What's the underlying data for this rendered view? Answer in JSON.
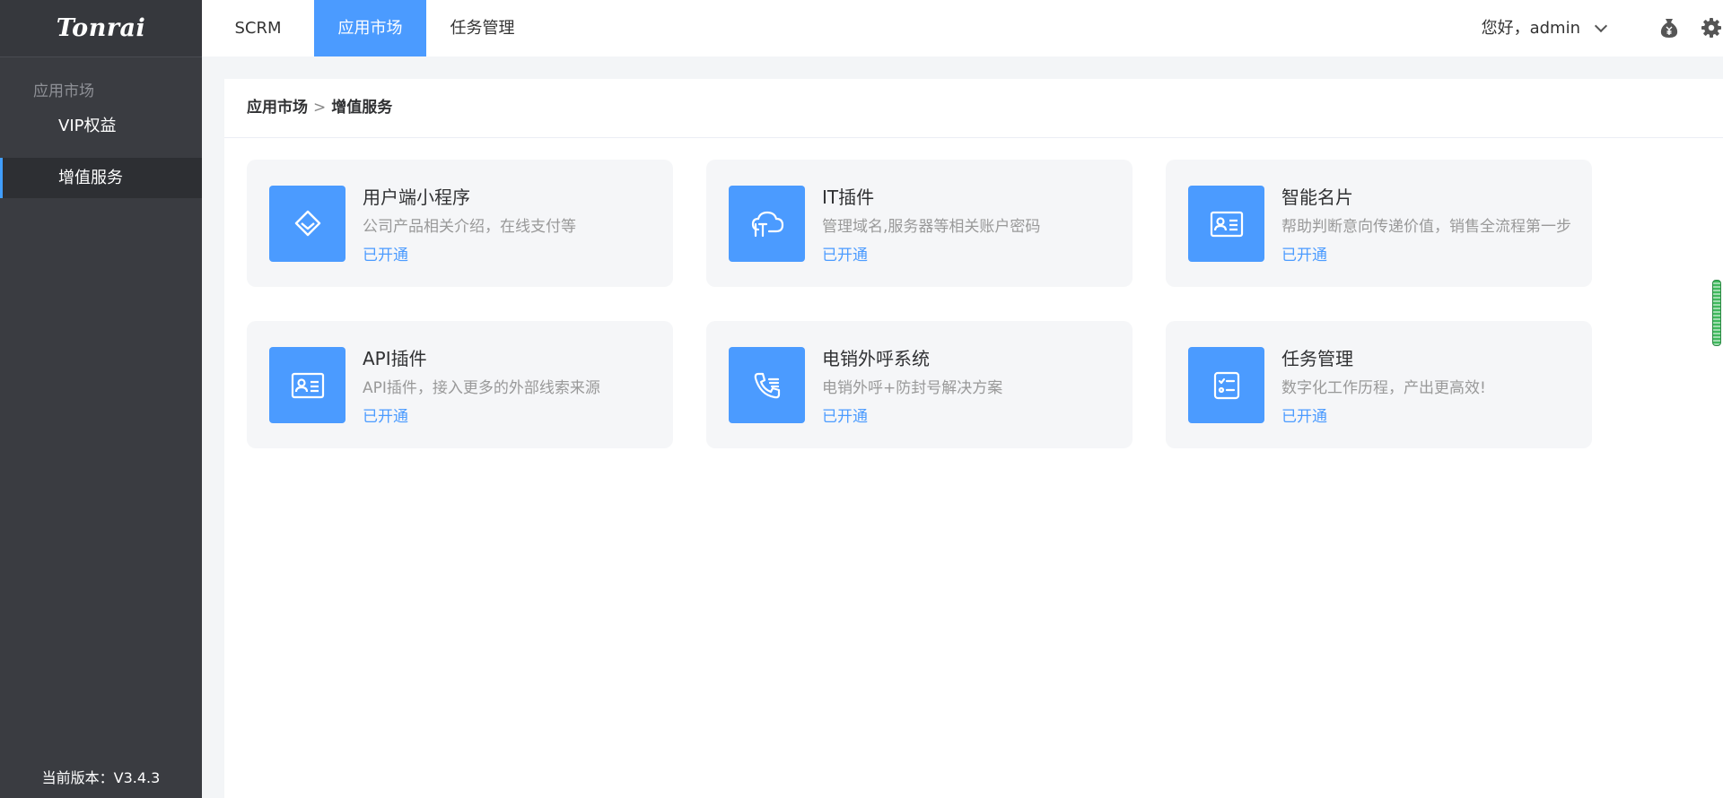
{
  "brand": {
    "logo_text": "Tonrai"
  },
  "sidebar": {
    "group_label": "应用市场",
    "items": [
      {
        "label": "VIP权益",
        "active": false
      },
      {
        "label": "增值服务",
        "active": true
      }
    ],
    "version_text": "当前版本：V3.4.3"
  },
  "topnav": {
    "tabs": [
      {
        "label": "SCRM",
        "active": false
      },
      {
        "label": "应用市场",
        "active": true
      },
      {
        "label": "任务管理",
        "active": false
      }
    ],
    "greeting": "您好，",
    "username": "admin",
    "icons": [
      "money-bag-icon",
      "gear-icon",
      "chevron-down-icon"
    ]
  },
  "breadcrumb": {
    "parent": "应用市场",
    "separator": ">",
    "current": "增值服务"
  },
  "cards": [
    {
      "title": "用户端小程序",
      "desc": "公司产品相关介绍，在线支付等",
      "status": "已开通",
      "icon": "diamond-icon"
    },
    {
      "title": "IT插件",
      "desc": "管理域名,服务器等相关账户密码",
      "status": "已开通",
      "icon": "it-cloud-icon"
    },
    {
      "title": "智能名片",
      "desc": "帮助判断意向传递价值，销售全流程第一步",
      "status": "已开通",
      "icon": "id-card-icon"
    },
    {
      "title": "API插件",
      "desc": "API插件，接入更多的外部线索来源",
      "status": "已开通",
      "icon": "id-card-icon"
    },
    {
      "title": "电销外呼系统",
      "desc": "电销外呼+防封号解决方案",
      "status": "已开通",
      "icon": "phone-call-icon"
    },
    {
      "title": "任务管理",
      "desc": "数字化工作历程，产出更高效!",
      "status": "已开通",
      "icon": "checklist-icon"
    }
  ],
  "colors": {
    "accent": "#4b9bff",
    "sidebar_bg": "#3a3c41",
    "card_bg": "#f5f6f8"
  }
}
